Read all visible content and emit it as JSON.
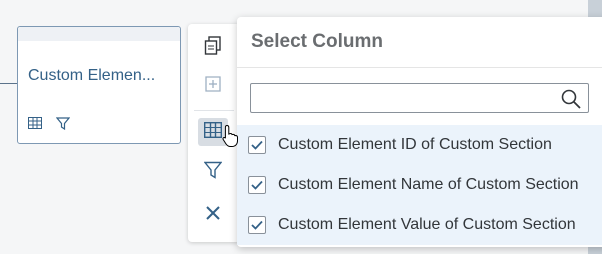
{
  "node": {
    "title": "Custom Elemen..."
  },
  "toolbar": {
    "items": [
      "copy-icon",
      "add-icon",
      "select-columns-icon",
      "filter-icon",
      "close-icon"
    ]
  },
  "popover": {
    "title": "Select Column",
    "search": {
      "value": "",
      "placeholder": ""
    },
    "columns": [
      {
        "label": "Custom Element ID of Custom Section",
        "checked": true
      },
      {
        "label": "Custom Element Name of Custom Section",
        "checked": true
      },
      {
        "label": "Custom Element Value of Custom Section",
        "checked": true
      }
    ]
  },
  "colors": {
    "accent": "#346187",
    "selected_row": "#ebf3fb",
    "active_tool": "#d8dde3"
  }
}
